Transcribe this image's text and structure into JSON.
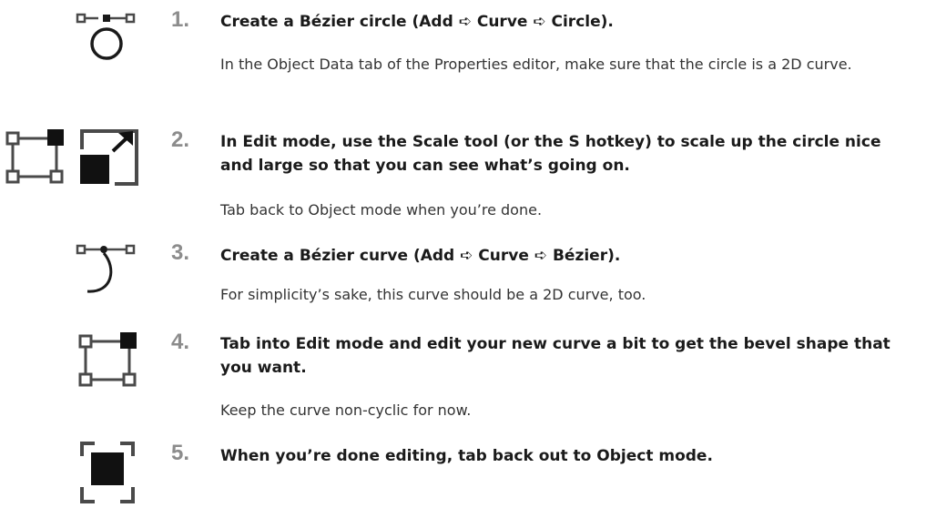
{
  "steps": [
    {
      "number": "1.",
      "heading": "Create a Bézier circle (Add ➪ Curve ➪ Circle).",
      "body": "In the Object Data tab of the Properties editor, make sure that the circle is a 2D curve.",
      "icons": [
        "bezier-circle-icon"
      ]
    },
    {
      "number": "2.",
      "heading": "In Edit mode, use the Scale tool (or the S hotkey) to scale up the circle nice and large so that you can see what’s going on.",
      "body": "Tab back to Object mode when you’re done.",
      "icons": [
        "edit-mode-icon",
        "scale-tool-icon"
      ]
    },
    {
      "number": "3.",
      "heading": "Create a Bézier curve (Add ➪ Curve ➪ Bézier).",
      "body": "For simplicity’s sake, this curve should be a 2D curve, too.",
      "icons": [
        "bezier-curve-icon"
      ]
    },
    {
      "number": "4.",
      "heading": "Tab into Edit mode and edit your new curve a bit to get the bevel shape that you want.",
      "body": "Keep the curve non-cyclic for now.",
      "icons": [
        "edit-mode-icon"
      ]
    },
    {
      "number": "5.",
      "heading": "When you’re done editing, tab back out to Object mode.",
      "body": "",
      "icons": [
        "object-mode-icon"
      ]
    }
  ]
}
